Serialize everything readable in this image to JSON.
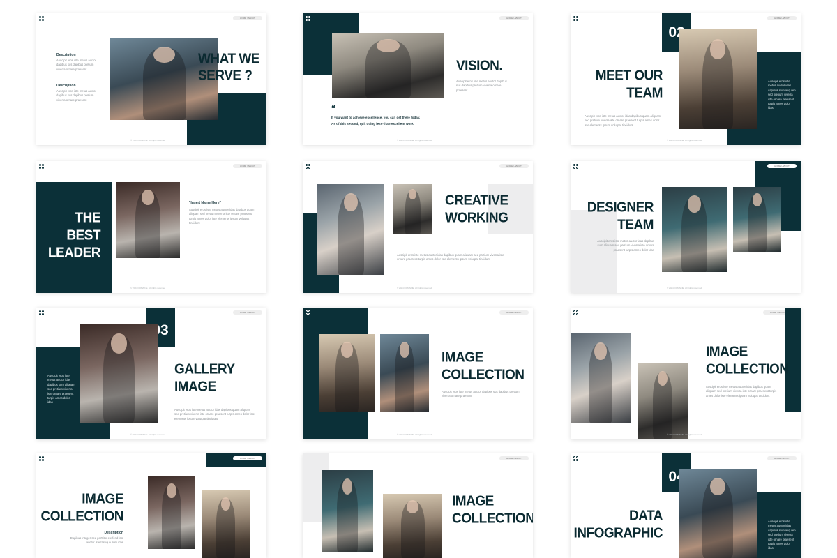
{
  "header_pill": "HOME / ABOUT",
  "footer": "© 2024 DOMAINE. All rights reserved",
  "lorem_short": "Auscipit eros iste metus auctor dapibus sus dapibus pretium viverra ornare praesent",
  "lorem_long": "Auscipit eros iste metus auctor idas dapibus quam aliquam sed pretium viverra iste ornare praesent turpis ames dolor iste elements ipsum volutpat tincidunt",
  "lorem_col": "Auscipit eros iste metus auctor idas dapibus sum aliquam sed pretium viverra iste ornare praesent turpis ames dolor idas",
  "slides": {
    "s1": {
      "title_1": "WHAT WE",
      "title_2": "SERVE ?",
      "desc_label_1": "Description",
      "desc_label_2": "Description"
    },
    "s2": {
      "title": "VISION.",
      "quote_mark": "❝",
      "quote_1": "If you want to achieve excellence, you can get there today.",
      "quote_2": "As of this second, quit doing less-than-excellent work."
    },
    "s3": {
      "number": "02",
      "title_1": "MEET OUR",
      "title_2": "TEAM"
    },
    "s4": {
      "title_1": "THE",
      "title_2": "BEST",
      "title_3": "LEADER",
      "name_label": "\"Insert Name Here\""
    },
    "s5": {
      "title_1": "CREATIVE",
      "title_2": "WORKING"
    },
    "s6": {
      "title_1": "DESIGNER",
      "title_2": "TEAM"
    },
    "s7": {
      "number": "03",
      "title_1": "GALLERY",
      "title_2": "IMAGE"
    },
    "s8": {
      "title_1": "IMAGE",
      "title_2": "COLLECTION"
    },
    "s9": {
      "title_1": "IMAGE",
      "title_2": "COLLECTION"
    },
    "s10": {
      "title_1": "IMAGE",
      "title_2": "COLLECTION",
      "desc_label": "Description",
      "desc_text": "Dapibus integer sed porttitor eleifend iste auctor iste tristique sum idas"
    },
    "s11": {
      "title_1": "IMAGE",
      "title_2": "COLLECTION"
    },
    "s12": {
      "number": "04",
      "title_1": "DATA",
      "title_2": "INFOGRAPHIC"
    }
  },
  "colors": {
    "accent": "#0b3038",
    "light_gray": "#ededee"
  }
}
